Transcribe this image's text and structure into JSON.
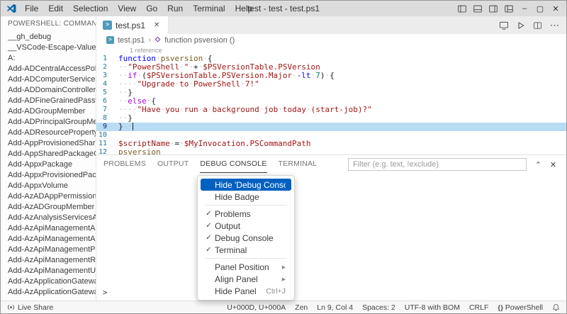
{
  "icons": {
    "close": "✕",
    "minimize": "–",
    "maximize": "▢",
    "chevron_up": "⌃",
    "more": "⋯",
    "check": "✓",
    "submenu_arrow": "▸",
    "breadcrumb_sep": "›",
    "ps_glyph": ">"
  },
  "titlebar": {
    "title": "test - test - test.ps1",
    "menus": [
      "File",
      "Edit",
      "Selection",
      "View",
      "Go",
      "Run",
      "Terminal",
      "Help"
    ]
  },
  "sidebar": {
    "header": "POWERSHELL: COMMAND E...",
    "items": [
      "__gh_debug",
      "__VSCode-Escape-Value",
      "A:",
      "Add-ADCentralAccessPolic...",
      "Add-ADComputerService...",
      "Add-ADDomainController...",
      "Add-ADFineGrainedPassw...",
      "Add-ADGroupMember",
      "Add-ADPrincipalGroupMe...",
      "Add-ADResourceProperty...",
      "Add-AppProvisionedShare...",
      "Add-AppSharedPackageC...",
      "Add-AppxPackage",
      "Add-AppxProvisionedPack...",
      "Add-AppxVolume",
      "Add-AzADAppPermission",
      "Add-AzADGroupMember",
      "Add-AzAnalysisServicesA...",
      "Add-AzApiManagementA...",
      "Add-AzApiManagementA...",
      "Add-AzApiManagementPr...",
      "Add-AzApiManagementR...",
      "Add-AzApiManagementU...",
      "Add-AzApplicationGatewa...",
      "Add-AzApplicationGatewa..."
    ]
  },
  "editor": {
    "tab_label": "test.ps1",
    "breadcrumb": {
      "file": "test.ps1",
      "symbol": "function psversion ()"
    },
    "codelens": "1 reference",
    "active_line": 9,
    "lines": [
      {
        "n": 1,
        "tokens": [
          {
            "t": "function",
            "c": "kw"
          },
          {
            "t": " ",
            "c": "pl"
          },
          {
            "t": "psversion",
            "c": "fn"
          },
          {
            "t": " {",
            "c": "pl"
          }
        ]
      },
      {
        "n": 2,
        "tokens": [
          {
            "t": "  ",
            "c": "pl"
          },
          {
            "t": "\"PowerShell \"",
            "c": "str"
          },
          {
            "t": " + ",
            "c": "pl"
          },
          {
            "t": "$PSVersionTable.PSVersion",
            "c": "var"
          }
        ]
      },
      {
        "n": 3,
        "tokens": [
          {
            "t": "  ",
            "c": "pl"
          },
          {
            "t": "if",
            "c": "ctrl"
          },
          {
            "t": " (",
            "c": "pl"
          },
          {
            "t": "$PSVersionTable.PSVersion.Major",
            "c": "var"
          },
          {
            "t": " ",
            "c": "pl"
          },
          {
            "t": "-lt",
            "c": "kw"
          },
          {
            "t": " ",
            "c": "pl"
          },
          {
            "t": "7",
            "c": "num"
          },
          {
            "t": ") {",
            "c": "pl"
          }
        ]
      },
      {
        "n": 4,
        "tokens": [
          {
            "t": "    ",
            "c": "pl"
          },
          {
            "t": "\"Upgrade to PowerShell 7!\"",
            "c": "str"
          }
        ]
      },
      {
        "n": 5,
        "tokens": [
          {
            "t": "  }",
            "c": "pl"
          }
        ]
      },
      {
        "n": 6,
        "tokens": [
          {
            "t": "  ",
            "c": "pl"
          },
          {
            "t": "else",
            "c": "ctrl"
          },
          {
            "t": " {",
            "c": "pl"
          }
        ]
      },
      {
        "n": 7,
        "tokens": [
          {
            "t": "    ",
            "c": "pl"
          },
          {
            "t": "\"Have you run a background job today (start-job)?\"",
            "c": "str"
          }
        ]
      },
      {
        "n": 8,
        "tokens": [
          {
            "t": "  }",
            "c": "pl"
          }
        ]
      },
      {
        "n": 9,
        "tokens": [
          {
            "t": "}",
            "c": "pl"
          },
          {
            "t": "  ",
            "c": "pl"
          }
        ]
      },
      {
        "n": 10,
        "tokens": []
      },
      {
        "n": 11,
        "tokens": [
          {
            "t": "$scriptName",
            "c": "var"
          },
          {
            "t": " = ",
            "c": "pl"
          },
          {
            "t": "$MyInvocation.PSCommandPath",
            "c": "var"
          }
        ]
      },
      {
        "n": 12,
        "tokens": [
          {
            "t": "psversion",
            "c": "fn"
          }
        ]
      }
    ]
  },
  "panel": {
    "tabs": [
      {
        "label": "PROBLEMS",
        "active": false
      },
      {
        "label": "OUTPUT",
        "active": false
      },
      {
        "label": "DEBUG CONSOLE",
        "active": true
      },
      {
        "label": "TERMINAL",
        "active": false
      }
    ],
    "filter_placeholder": "Filter (e.g. text, !exclude)",
    "prompt": ">"
  },
  "context_menu": {
    "items": [
      {
        "label": "Hide 'Debug Console'",
        "highlighted": true
      },
      {
        "label": "Hide Badge"
      },
      {
        "separator": true
      },
      {
        "label": "Problems",
        "checked": true
      },
      {
        "label": "Output",
        "checked": true
      },
      {
        "label": "Debug Console",
        "checked": true
      },
      {
        "label": "Terminal",
        "checked": true
      },
      {
        "separator": true
      },
      {
        "label": "Panel Position",
        "submenu": true
      },
      {
        "label": "Align Panel",
        "submenu": true
      },
      {
        "label": "Hide Panel",
        "shortcut": "Ctrl+J"
      }
    ]
  },
  "statusbar": {
    "left": [
      {
        "icon": "live-share",
        "label": "Live Share"
      }
    ],
    "right": [
      {
        "label": "U+000D, U+000A"
      },
      {
        "label": "Zen"
      },
      {
        "label": "Ln 9, Col 4"
      },
      {
        "label": "Spaces: 2"
      },
      {
        "label": "UTF-8 with BOM"
      },
      {
        "label": "CRLF"
      },
      {
        "icon": "braces",
        "label": "PowerShell"
      },
      {
        "icon": "bell",
        "label": ""
      }
    ]
  },
  "colors": {
    "accent": "#0060c0",
    "active_line_highlight": "#b9dcf5",
    "string": "#a31515",
    "keyword": "#0000ff",
    "control_keyword": "#af00db",
    "number": "#098658",
    "variable": "#a31515",
    "function_name": "#795e26",
    "line_number": "#237893",
    "titlebar_bg": "#dcdcdc"
  }
}
